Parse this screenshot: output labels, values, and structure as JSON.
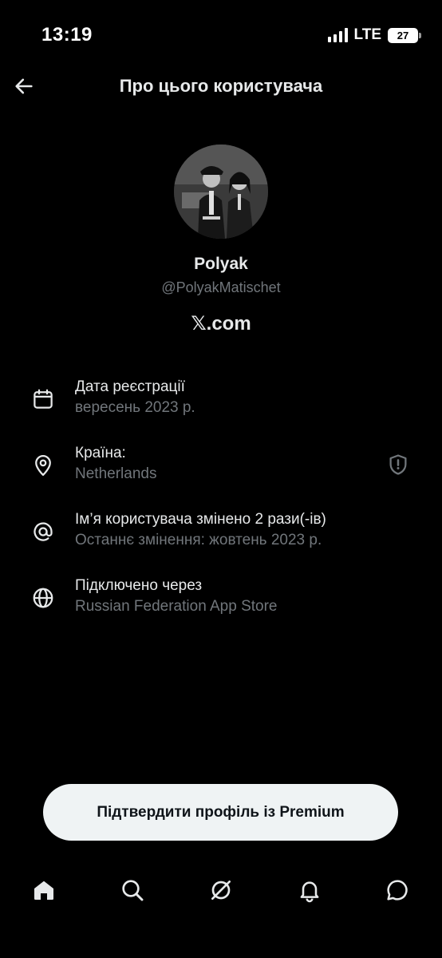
{
  "status_bar": {
    "time": "13:19",
    "network": "LTE",
    "battery": "27"
  },
  "header": {
    "title": "Про цього користувача",
    "back_icon": "arrow-left-icon"
  },
  "profile": {
    "display_name": "Polyak",
    "handle": "@PolyakMatischet",
    "site": "𝕏.com"
  },
  "info": [
    {
      "icon": "calendar-icon",
      "title": "Дата реєстрації",
      "subtitle": "вересень 2023 р."
    },
    {
      "icon": "location-pin-icon",
      "title": "Країна:",
      "subtitle": "Netherlands",
      "extra_icon": "shield-alert-icon"
    },
    {
      "icon": "at-sign-icon",
      "title": "Ім’я користувача змінено 2 рази(-ів)",
      "subtitle": "Останнє змінення: жовтень 2023 р."
    },
    {
      "icon": "globe-icon",
      "title": "Підключено через",
      "subtitle": "Russian Federation App Store"
    }
  ],
  "premium_button": {
    "label": "Підтвердити профіль із Premium"
  },
  "tab_bar": {
    "items": [
      "home-icon",
      "search-icon",
      "grok-icon",
      "bell-icon",
      "chat-bubble-icon"
    ]
  },
  "colors": {
    "background": "#000000",
    "primary_text": "#e7e9ea",
    "secondary_text": "#71767b",
    "button_bg": "#eff3f4"
  }
}
